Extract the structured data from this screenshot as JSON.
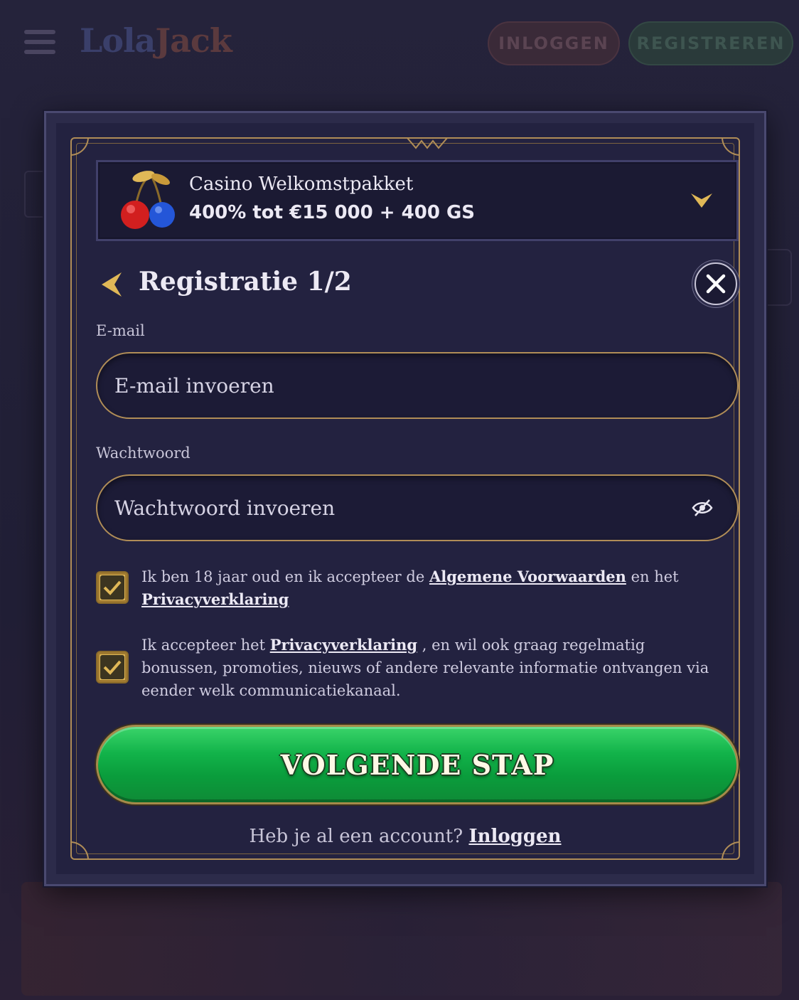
{
  "background": {
    "logo_part1": "Lola",
    "logo_part2": "Jack",
    "login_button": "INLOGGEN",
    "register_button": "REGISTREREN"
  },
  "bonus": {
    "title": "Casino Welkomstpakket",
    "offer": "400% tot €15 000 + 400 GS",
    "icon": "cherries-icon"
  },
  "form": {
    "title": "Registratie 1/2",
    "email": {
      "label": "E-mail",
      "placeholder": "E-mail invoeren",
      "value": ""
    },
    "password": {
      "label": "Wachtwoord",
      "placeholder": "Wachtwoord invoeren",
      "value": ""
    },
    "terms": {
      "checked": true,
      "text_before": "Ik ben 18 jaar oud en ik accepteer de ",
      "link1": "Algemene Voorwaarden",
      "text_middle": " en het ",
      "link2": "Privacyverklaring"
    },
    "marketing": {
      "checked": true,
      "text_before": "Ik accepteer het ",
      "link": "Privacyverklaring",
      "text_after": " , en wil ook graag regelmatig bonussen, promoties, nieuws of andere relevante informatie ontvangen via eender welk communicatiekanaal."
    },
    "next_button": "VOLGENDE STAP",
    "login_prompt": "Heb je al een account? ",
    "login_link": "Inloggen"
  },
  "colors": {
    "gold": "#b08d57",
    "green": "#12b34a",
    "panel": "#232240"
  }
}
